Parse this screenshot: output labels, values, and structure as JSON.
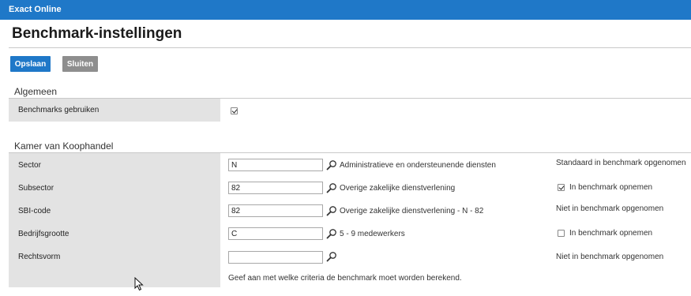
{
  "app": {
    "title": "Exact Online"
  },
  "page": {
    "title": "Benchmark-instellingen"
  },
  "toolbar": {
    "save_label": "Opslaan",
    "close_label": "Sluiten"
  },
  "general": {
    "heading": "Algemeen",
    "use_benchmarks_label": "Benchmarks gebruiken",
    "use_benchmarks_checked": true
  },
  "kvk": {
    "heading": "Kamer van Koophandel",
    "rows": [
      {
        "label": "Sector",
        "value": "N",
        "description": "Administratieve en ondersteunende diensten",
        "status_text": "Standaard in benchmark opgenomen",
        "has_checkbox": false
      },
      {
        "label": "Subsector",
        "value": "82",
        "description": "Overige zakelijke dienstverlening",
        "status_text": "In benchmark opnemen",
        "has_checkbox": true,
        "checked": true
      },
      {
        "label": "SBI-code",
        "value": "82",
        "description": "Overige zakelijke dienstverlening - N - 82",
        "status_text": "Niet in benchmark opgenomen",
        "has_checkbox": false
      },
      {
        "label": "Bedrijfsgrootte",
        "value": "C",
        "description": "5 - 9 medewerkers",
        "status_text": "In benchmark opnemen",
        "has_checkbox": true,
        "checked": false
      },
      {
        "label": "Rechtsvorm",
        "value": "",
        "description": "",
        "status_text": "Niet in benchmark opgenomen",
        "has_checkbox": false
      }
    ],
    "footer_note": "Geef aan met welke criteria de benchmark moet worden berekend."
  },
  "icons": {
    "lookup": "magnifier-icon",
    "cursor": "mouse-pointer-icon"
  },
  "colors": {
    "topbar": "#1f78c8",
    "primary_button": "#1f78c8",
    "secondary_button": "#8e8e8e",
    "label_background": "#e3e3e3"
  }
}
